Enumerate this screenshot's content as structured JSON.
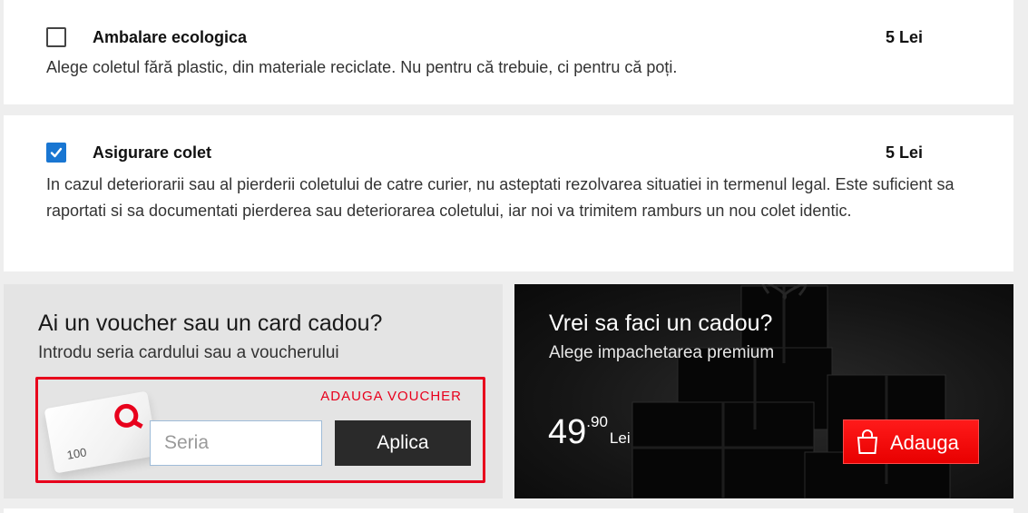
{
  "options": [
    {
      "title": "Ambalare ecologica",
      "price": "5 Lei",
      "checked": false,
      "description": "Alege coletul fără plastic, din materiale reciclate. Nu pentru că trebuie, ci pentru că poți."
    },
    {
      "title": "Asigurare colet",
      "price": "5 Lei",
      "checked": true,
      "description": "In cazul deteriorarii sau al pierderii coletului de catre curier, nu asteptati rezolvarea situatiei in termenul legal. Este suficient sa raportati si sa documentati pierderea sau deteriorarea coletului, iar noi va trimitem ramburs un nou colet identic."
    }
  ],
  "voucher": {
    "title": "Ai un voucher sau un card cadou?",
    "subtitle": "Introdu seria cardului sau a voucherului",
    "add_link": "ADAUGA VOUCHER",
    "card_amount": "100",
    "input_placeholder": "Seria",
    "input_value": "",
    "apply_label": "Aplica"
  },
  "gift": {
    "title": "Vrei sa faci un cadou?",
    "subtitle": "Alege impachetarea premium",
    "price_int": "49",
    "price_dec": ".90",
    "currency": "Lei",
    "add_label": "Adauga",
    "add_icon": "shopping-bag-icon"
  },
  "colors": {
    "accent_red": "#e8001c",
    "checkbox_blue": "#1976d2",
    "dark_button": "#2a2a2a"
  }
}
